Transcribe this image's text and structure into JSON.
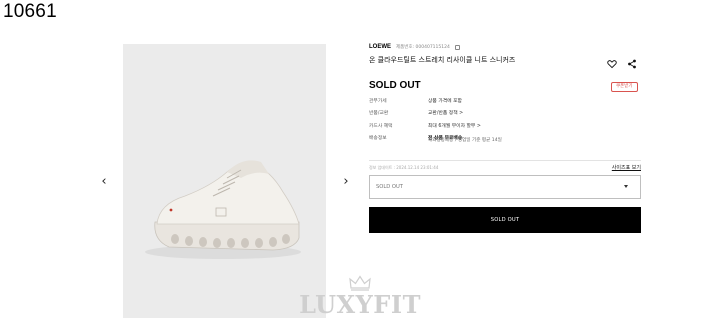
{
  "item_code": "10661",
  "nav": {
    "prev_glyph": "‹",
    "next_glyph": "›"
  },
  "image": {
    "icon": "sneaker-image",
    "background": "#ebebeb"
  },
  "product": {
    "brand": "LOEWE",
    "product_no": "제품번호: 000407115124",
    "name": "온 클라우드틸트 스트레치 리사이클 니트 스니커즈"
  },
  "actions": {
    "wish_icon": "heart-icon",
    "share_icon": "share-icon"
  },
  "status": {
    "title": "SOLD OUT",
    "chip": "쿠폰받기",
    "chip_color": "#d9534f"
  },
  "info": [
    {
      "label": "관부가세",
      "value": "상품 가격에 포함",
      "bold": false
    },
    {
      "label": "반품/교환",
      "value": "교환/반품 정책 >",
      "bold": false
    },
    {
      "label": "카드사 혜택",
      "value": "최대 6개월 무이자 할부 >",
      "bold": false
    },
    {
      "label": "배송정보",
      "value": "전 상품 무료배송",
      "bold": true
    }
  ],
  "shipping_sub": "해외중동배송 / 영업일 기준 평균 14일",
  "meta": {
    "text": "정보 업데이트 : 2024.12.14 23:01:44",
    "size_guide": "사이즈표 보기"
  },
  "option": {
    "selected": "SOLD OUT"
  },
  "buy_button": {
    "label": "SOLD OUT",
    "background": "#000000"
  },
  "watermark": {
    "text": "LUXYFIT",
    "icon": "crown-icon"
  }
}
